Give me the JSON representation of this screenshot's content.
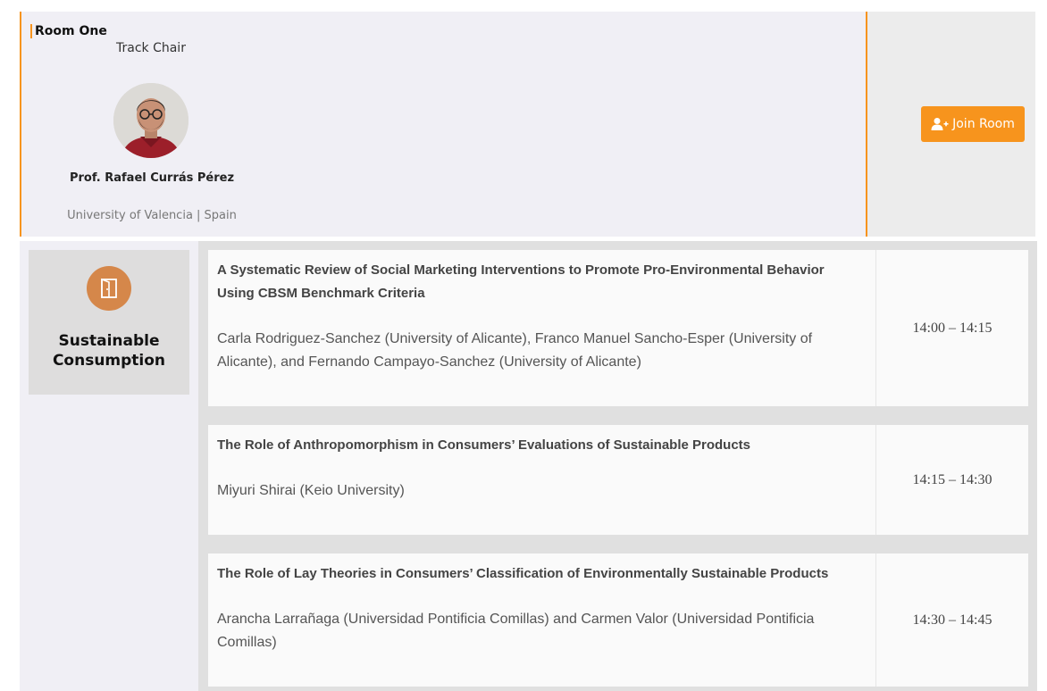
{
  "room": {
    "title": "Room One",
    "role": "Track Chair",
    "chair_name": "Prof. Rafael Currás Pérez",
    "chair_affiliation": "University of Valencia | Spain",
    "join_label": "Join Room",
    "join_icon": "user-plus-icon"
  },
  "track": {
    "name": "Sustainable Consumption",
    "icon": "door-exit-icon"
  },
  "talks": [
    {
      "title": "A Systematic Review of Social Marketing Interventions to Promote Pro-Environmental Behavior Using CBSM Benchmark Criteria",
      "authors": "Carla Rodriguez-Sanchez (University of Alicante), Franco Manuel Sancho-Esper (University of Alicante), and Fernando Campayo-Sanchez (University of Alicante)",
      "time": "14:00 – 14:15"
    },
    {
      "title": "The Role of Anthropomorphism in Consumers’ Evaluations of Sustainable Products",
      "authors": "Miyuri Shirai (Keio University)",
      "time": "14:15 – 14:30"
    },
    {
      "title": "The Role of Lay Theories in Consumers’ Classification of Environmentally Sustainable Products",
      "authors": "Arancha Larrañaga (Universidad Pontificia Comillas) and Carmen Valor (Universidad Pontificia Comillas)",
      "time": "14:30 – 14:45"
    }
  ],
  "colors": {
    "accent": "#f7941d",
    "track_icon_bg": "#d5874a"
  }
}
